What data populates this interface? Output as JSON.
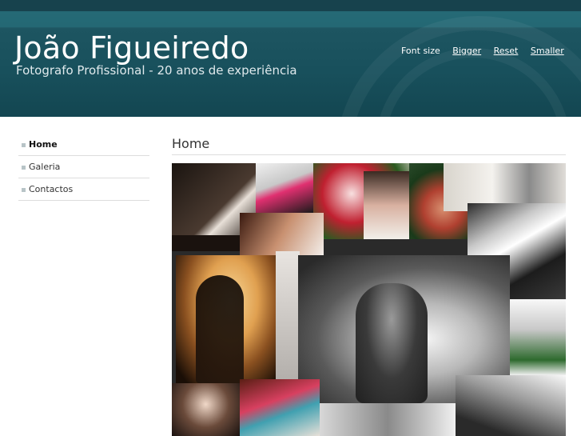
{
  "header": {
    "title": "João Figueiredo",
    "subtitle": "Fotografo Profissional - 20 anos de experiência",
    "font_size": {
      "label": "Font size",
      "bigger": "Bigger",
      "reset": "Reset",
      "smaller": "Smaller"
    }
  },
  "sidebar": {
    "items": [
      {
        "label": "Home",
        "active": true
      },
      {
        "label": "Galeria",
        "active": false
      },
      {
        "label": "Contactos",
        "active": false
      }
    ]
  },
  "main": {
    "page_title": "Home",
    "image": "wedding-photo-collage"
  },
  "colors": {
    "header_bg": "#1d5561",
    "header_text": "#ffffff",
    "divider": "#dddddd",
    "bullet": "#b8c4c7"
  }
}
